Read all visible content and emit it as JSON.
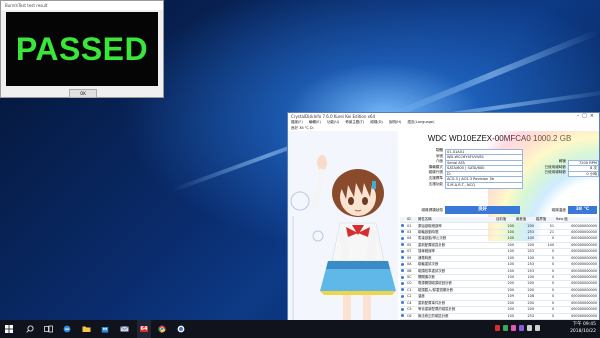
{
  "burnin": {
    "title": "BurnInTest test result",
    "result": "PASSED",
    "ok_label": "OK"
  },
  "cdi": {
    "title": "CrystalDiskInfo 7.6.0 Kurei Kei Edition x64",
    "menu": [
      "檔案(F)",
      "編輯(E)",
      "功能(U)",
      "佈景主題(T)",
      "磁碟(D)",
      "說明(H)",
      "語言(Language)"
    ],
    "subline": "良好 38 °C  D:",
    "model": "WDC WD10EZEX-00MFCA0 1000.2 GB",
    "info": [
      {
        "label": "韌體",
        "value": "01.01A01",
        "rlabel": "",
        "rvalue": ""
      },
      {
        "label": "序號",
        "value": "WD-WCC6Y4FUVV81",
        "rlabel": "",
        "rvalue": ""
      },
      {
        "label": "介面",
        "value": "Serial ATA",
        "rlabel": "轉速",
        "rvalue": "7200 RPM"
      },
      {
        "label": "傳輸模式",
        "value": "SATA/600 | SATA/600",
        "rlabel": "已使用總時數",
        "rvalue": "8 次"
      },
      {
        "label": "磁碟代號",
        "value": "D:",
        "rlabel": "已使用總時數",
        "rvalue": "0 小時"
      },
      {
        "label": "支援標準",
        "value": "ACS-3 | ACS-3 Revision 3b",
        "rlabel": "",
        "rvalue": ""
      },
      {
        "label": "支援功能",
        "value": "S.M.A.R.T., NCQ",
        "rlabel": "",
        "rvalue": ""
      }
    ],
    "health_label": "磁碟健康狀態",
    "health_value": "良好",
    "temp_label": "磁碟溫度",
    "temp_value": "38 °C",
    "smart_headers": [
      "ID",
      "屬性名稱",
      "目前值",
      "最差值",
      "臨界值",
      "Raw 值"
    ],
    "smart": [
      [
        "01",
        "原始讀取錯誤率",
        "200",
        "200",
        "51",
        "000000000000"
      ],
      [
        "03",
        "磁軸啟動時間",
        "100",
        "253",
        "21",
        "000000000000"
      ],
      [
        "04",
        "馬達啟動/停止次數",
        "100",
        "100",
        "0",
        "000000000000"
      ],
      [
        "05",
        "重新配置磁區計數",
        "200",
        "200",
        "140",
        "000000000000"
      ],
      [
        "07",
        "搜尋錯誤率",
        "100",
        "253",
        "0",
        "000000000000"
      ],
      [
        "09",
        "通電時數",
        "100",
        "100",
        "0",
        "000000000000"
      ],
      [
        "0A",
        "磁軸重試次數",
        "100",
        "253",
        "0",
        "000000000000"
      ],
      [
        "0B",
        "磁頭校準重試次數",
        "100",
        "253",
        "0",
        "000000000000"
      ],
      [
        "0C",
        "開關機次數",
        "100",
        "100",
        "0",
        "000000000000"
      ],
      [
        "C0",
        "電源關閉磁頭收回計數",
        "200",
        "200",
        "0",
        "000000000000"
      ],
      [
        "C1",
        "磁頭載入/卸載週期計數",
        "200",
        "200",
        "0",
        "000000000000"
      ],
      [
        "C2",
        "溫度",
        "109",
        "108",
        "0",
        "000000000000"
      ],
      [
        "C4",
        "重新配置事件計數",
        "200",
        "200",
        "0",
        "000000000000"
      ],
      [
        "C5",
        "等待重新配置的磁區計數",
        "200",
        "200",
        "0",
        "000000000000"
      ],
      [
        "C6",
        "無法修正的磁區計數",
        "100",
        "253",
        "0",
        "000000000000"
      ],
      [
        "C7",
        "UltraDMA 傳輸錯誤計數",
        "200",
        "200",
        "0",
        "000000000000"
      ],
      [
        "C8",
        "寫入錯誤率",
        "100",
        "253",
        "0",
        "000000000000"
      ]
    ],
    "footer": "霧井慧",
    "pronama": "© Pronama LLC"
  },
  "taskbar": {
    "badge": "64",
    "time": "下午 09:45",
    "date": "2018/10/22"
  },
  "colors": {
    "passed_green": "#39e639",
    "good_blue": "#3a78d8",
    "taskbar": "#10131c"
  }
}
